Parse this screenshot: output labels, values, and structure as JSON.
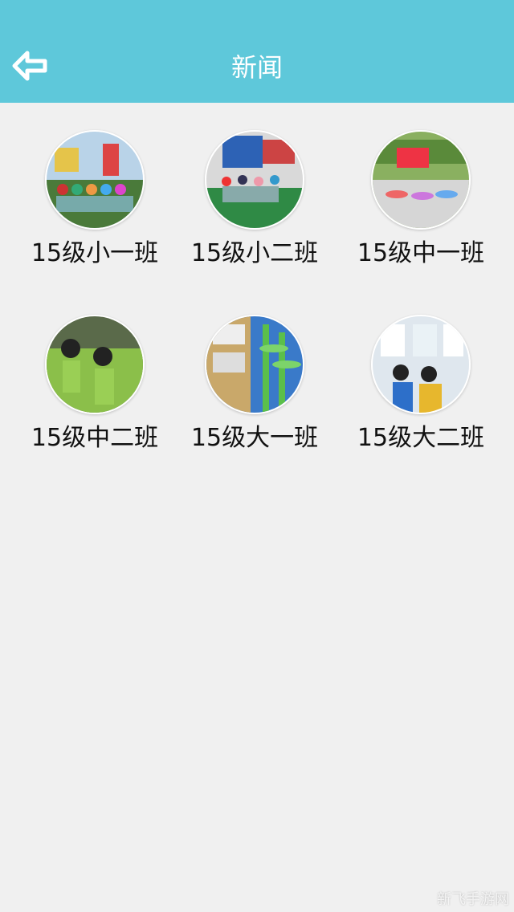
{
  "header": {
    "title": "新闻",
    "back_icon": "back-arrow-icon"
  },
  "colors": {
    "header": "#5ec8da",
    "background": "#f0f0f0"
  },
  "classes": [
    {
      "label": "15级小一班",
      "photo": "kids-playground-photo"
    },
    {
      "label": "15级小二班",
      "photo": "kids-courtyard-photo"
    },
    {
      "label": "15级中一班",
      "photo": "kids-exercise-photo"
    },
    {
      "label": "15级中二班",
      "photo": "kids-dance-photo"
    },
    {
      "label": "15级大一班",
      "photo": "bamboo-wall-display-photo"
    },
    {
      "label": "15级大二班",
      "photo": "kids-gallery-photo"
    }
  ],
  "watermark": "新飞手游网"
}
